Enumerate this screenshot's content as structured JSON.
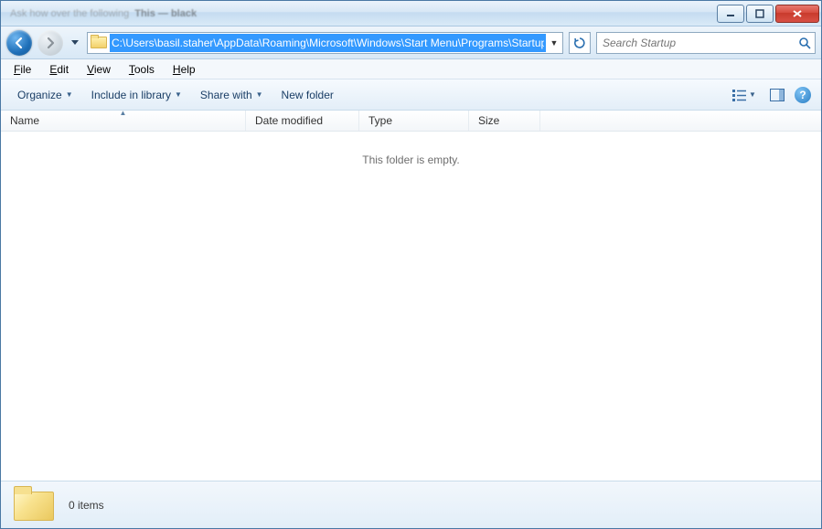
{
  "titlebar": {
    "blurred_text_1": "Ask how over the following",
    "blurred_text_2": "This — black"
  },
  "nav": {
    "address": "C:\\Users\\basil.staher\\AppData\\Roaming\\Microsoft\\Windows\\Start Menu\\Programs\\Startup",
    "search_placeholder": "Search Startup"
  },
  "menu": {
    "file": "File",
    "edit": "Edit",
    "view": "View",
    "tools": "Tools",
    "help": "Help"
  },
  "toolbar": {
    "organize": "Organize",
    "include": "Include in library",
    "share": "Share with",
    "newfolder": "New folder"
  },
  "columns": {
    "name": "Name",
    "date": "Date modified",
    "type": "Type",
    "size": "Size"
  },
  "content": {
    "empty": "This folder is empty."
  },
  "status": {
    "items": "0 items"
  }
}
